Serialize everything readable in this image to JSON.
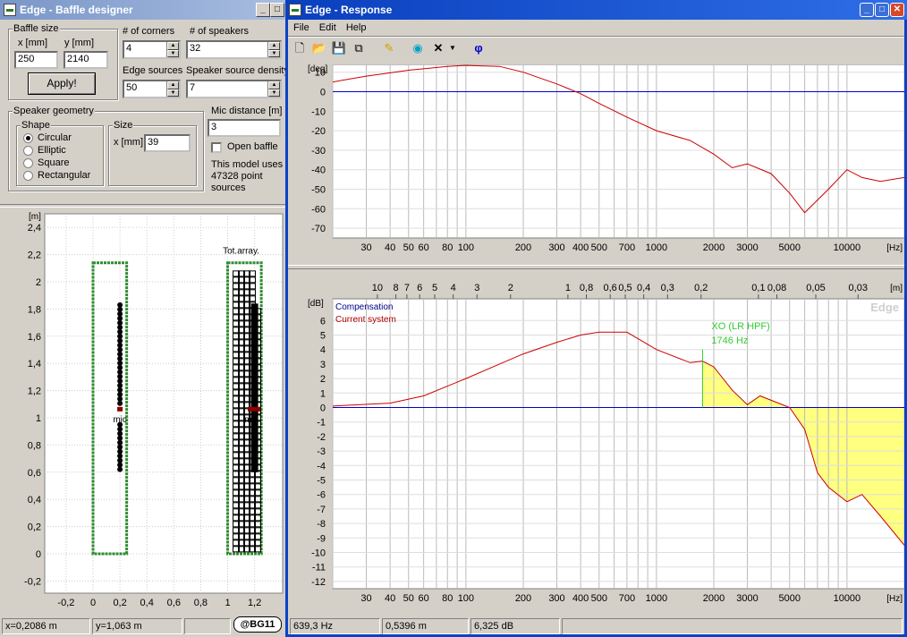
{
  "baffle": {
    "title": "Edge - Baffle designer",
    "size_group": "Baffle size",
    "x_label": "x [mm]",
    "y_label": "y [mm]",
    "x_value": "250",
    "y_value": "2140",
    "apply_label": "Apply!",
    "corners_label": "# of corners",
    "corners_value": "4",
    "speakers_label": "# of speakers",
    "speakers_value": "32",
    "edge_sources_label": "Edge sources",
    "edge_sources_value": "50",
    "speaker_density_label": "Speaker source density",
    "speaker_density_value": "7",
    "geometry_group": "Speaker geometry",
    "shape_group": "Shape",
    "shapes": [
      "Circular",
      "Elliptic",
      "Square",
      "Rectangular"
    ],
    "selected_shape": "Circular",
    "size_group_label": "Size",
    "size_x_label": "x [mm]",
    "size_x_value": "39",
    "mic_distance_label": "Mic distance [m]",
    "mic_distance_value": "3",
    "open_baffle_label": "Open baffle",
    "open_baffle_checked": false,
    "model_info": [
      "This model uses",
      "47328 point",
      "sources"
    ],
    "plot": {
      "unit": "[m]",
      "y_ticks": [
        "2,4",
        "2,2",
        "2",
        "1,8",
        "1,6",
        "1,4",
        "1,2",
        "1",
        "0,8",
        "0,6",
        "0,4",
        "0,2",
        "0",
        "-0,2"
      ],
      "x_ticks": [
        "-0,2",
        "0",
        "0,2",
        "0,4",
        "0,6",
        "0,8",
        "1",
        "1,2"
      ],
      "mic_label": "mic",
      "array_mic_label": "mic",
      "total_array_label": "Tot.array.",
      "colors": {
        "baffle": "#2e8b2e",
        "speaker": "#000000",
        "mic": "#8b0000"
      }
    },
    "status": {
      "x": "x=0,2086 m",
      "y": "y=1,063 m",
      "badge": "@BG11"
    }
  },
  "response": {
    "title": "Edge - Response",
    "menu": [
      "File",
      "Edit",
      "Help"
    ],
    "toolbar_icons": [
      "new-icon",
      "open-icon",
      "save-icon",
      "copy-icon",
      "pencil-icon",
      "globe-icon",
      "delete-icon",
      "dropdown-arrow-icon",
      "phi-icon"
    ],
    "phase": {
      "unit": "[deg]",
      "y_ticks": [
        "10",
        "0",
        "-10",
        "-20",
        "-30",
        "-40",
        "-50",
        "-60",
        "-70"
      ],
      "x_ticks": [
        "30",
        "40",
        "50",
        "60",
        "80",
        "100",
        "200",
        "300",
        "400",
        "500",
        "700",
        "1000",
        "2000",
        "3000",
        "5000",
        "10000"
      ],
      "x_unit": "[Hz]"
    },
    "mag": {
      "unit": "[dB]",
      "y_ticks": [
        "6",
        "5",
        "4",
        "3",
        "2",
        "1",
        "0",
        "-1",
        "-2",
        "-3",
        "-4",
        "-5",
        "-6",
        "-7",
        "-8",
        "-9",
        "-10",
        "-11",
        "-12"
      ],
      "x_ticks": [
        "30",
        "40",
        "50",
        "60",
        "80",
        "100",
        "200",
        "300",
        "400",
        "500",
        "700",
        "1000",
        "2000",
        "3000",
        "5000",
        "10000"
      ],
      "x_unit": "[Hz]",
      "top_unit": "[m]",
      "top_ticks": [
        "10",
        "8",
        "7",
        "6",
        "5",
        "4",
        "3",
        "2",
        "1",
        "0,8",
        "0,6",
        "0,5",
        "0,4",
        "0,3",
        "0,2",
        "0,1",
        "0,08",
        "0,05",
        "0,03"
      ],
      "legend": [
        "Compensation",
        "Current system"
      ],
      "legend_colors": [
        "#00008b",
        "#b00000"
      ],
      "watermark": "Edge",
      "xo_label": "XO (LR HPF)",
      "xo_freq": "1746 Hz",
      "xo_color": "#33cc33"
    },
    "status": {
      "freq": "639,3 Hz",
      "dist": "0,5396 m",
      "level": "6,325 dB"
    }
  },
  "chart_data": [
    {
      "type": "line",
      "xscale": "log",
      "x": [
        20,
        30,
        50,
        80,
        100,
        150,
        200,
        300,
        400,
        500,
        700,
        1000,
        1500,
        2000,
        2500,
        3000,
        4000,
        5000,
        6000,
        8000,
        10000,
        12000,
        15000,
        20000
      ],
      "series": [
        {
          "values": [
            5,
            8,
            11,
            13,
            13.5,
            13,
            10,
            4,
            -1,
            -6,
            -13,
            -20,
            -25,
            -32,
            -39,
            -37,
            -42,
            -52,
            -62,
            -50,
            -40,
            -44,
            -46,
            -44
          ]
        }
      ],
      "ylabel": "[deg]",
      "xlabel": "[Hz]",
      "xlim": [
        20,
        20000
      ],
      "ylim": [
        -75,
        14
      ],
      "zero_line_color": "#0000cc",
      "line_color": "#cc0000",
      "grid": true
    },
    {
      "type": "line",
      "xscale": "log",
      "x": [
        20,
        40,
        60,
        100,
        150,
        200,
        300,
        400,
        500,
        700,
        1000,
        1500,
        1746,
        2000,
        2500,
        3000,
        3500,
        4000,
        5000,
        6000,
        7000,
        8000,
        10000,
        12000,
        15000,
        20000
      ],
      "series": [
        {
          "values": [
            0.1,
            0.3,
            0.8,
            2.0,
            3.0,
            3.7,
            4.5,
            5.0,
            5.2,
            5.2,
            4.0,
            3.1,
            3.2,
            2.8,
            1.2,
            0.2,
            0.8,
            0.5,
            0,
            -1.5,
            -4.5,
            -5.5,
            -6.5,
            -6.0,
            -7.5,
            -9.5
          ]
        }
      ],
      "xo_frequency": 1746,
      "ylabel": "[dB]",
      "xlabel": "[Hz]",
      "xlim": [
        20,
        20000
      ],
      "ylim": [
        -12.5,
        7.5
      ],
      "zero_line_color": "#0000cc",
      "line_color": "#cc0000",
      "fill_color": "#ffff80",
      "grid": true
    }
  ]
}
